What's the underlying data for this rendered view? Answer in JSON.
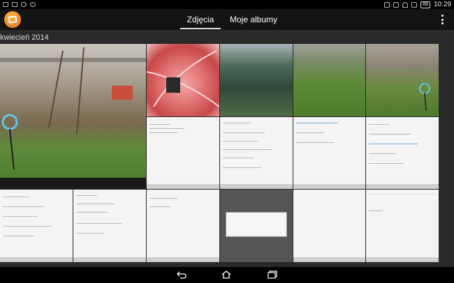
{
  "status_bar": {
    "time": "10:29",
    "battery": "88",
    "left_icons": [
      "photo-icon",
      "mail-icon",
      "twitter-icon",
      "at-icon"
    ],
    "right_icons": [
      "nfc-icon",
      "vibrate-icon",
      "wifi-icon",
      "no-sim-icon",
      "battery-icon"
    ]
  },
  "action_bar": {
    "app_icon": "album-app-icon",
    "tabs": [
      {
        "label": "Zdjęcia",
        "selected": true
      },
      {
        "label": "Moje albumy",
        "selected": false
      }
    ],
    "overflow_icon": "overflow-menu-icon"
  },
  "gallery": {
    "section_header": "kwiecień 2014"
  },
  "nav_bar": {
    "icons": [
      "back-icon",
      "home-icon",
      "recent-apps-icon"
    ]
  },
  "colors": {
    "background": "#2a2a2a",
    "bar": "#141414",
    "app_icon": "#e96e1b"
  }
}
